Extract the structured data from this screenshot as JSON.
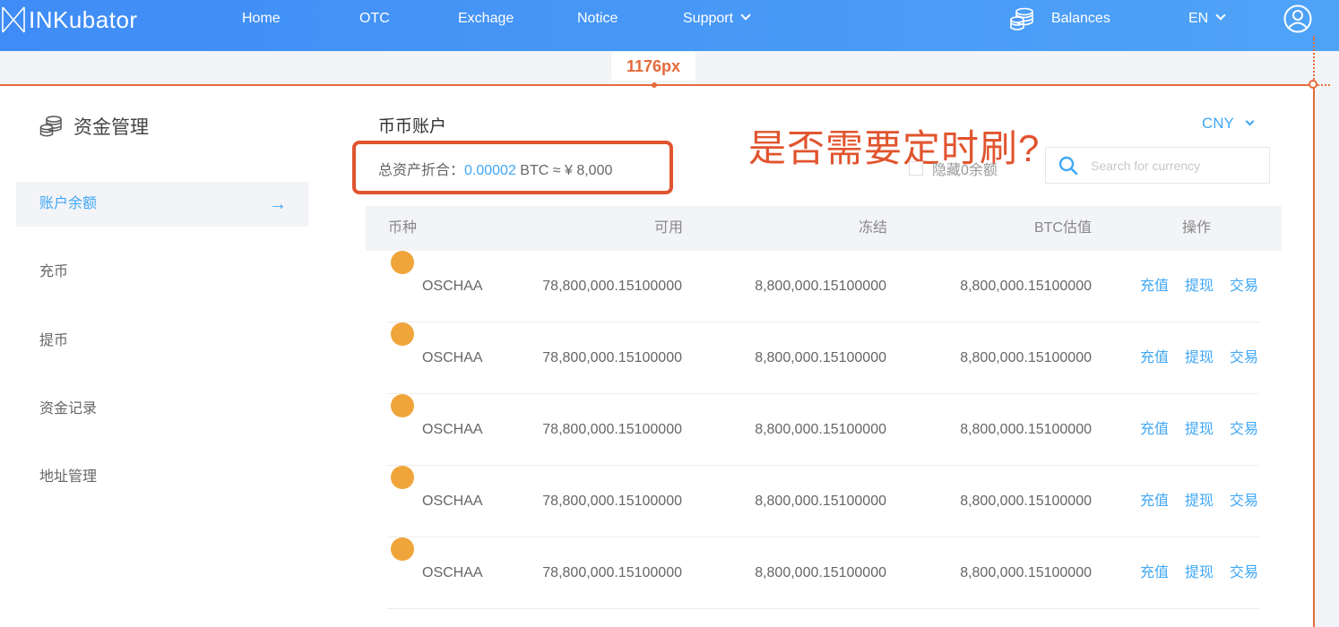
{
  "header": {
    "logo_text": "INKubator",
    "nav": [
      "Home",
      "OTC",
      "Exchage",
      "Notice",
      "Support"
    ],
    "balances_label": "Balances",
    "language": "EN"
  },
  "annotation": {
    "width_label": "1176px",
    "question": "是否需要定时刷?"
  },
  "sidebar": {
    "title": "资金管理",
    "items": [
      {
        "label": "账户余额",
        "active": true
      },
      {
        "label": "充币"
      },
      {
        "label": "提币"
      },
      {
        "label": "资金记录"
      },
      {
        "label": "地址管理"
      }
    ],
    "active_arrow": "→"
  },
  "main": {
    "title": "币币账户",
    "total_label": "总资产折合：",
    "total_btc": "0.00002",
    "total_rest": " BTC ≈ ¥ 8,000",
    "currency": "CNY",
    "hide_zero_label": "隐藏0余额",
    "search_placeholder": "Search for currency",
    "columns": [
      "币种",
      "可用",
      "冻结",
      "BTC估值",
      "操作"
    ],
    "rows": [
      {
        "coin": "OSCHAA",
        "available": "78,800,000.15100000",
        "frozen": "8,800,000.15100000",
        "btc_value": "8,800,000.15100000"
      },
      {
        "coin": "OSCHAA",
        "available": "78,800,000.15100000",
        "frozen": "8,800,000.15100000",
        "btc_value": "8,800,000.15100000"
      },
      {
        "coin": "OSCHAA",
        "available": "78,800,000.15100000",
        "frozen": "8,800,000.15100000",
        "btc_value": "8,800,000.15100000"
      },
      {
        "coin": "OSCHAA",
        "available": "78,800,000.15100000",
        "frozen": "8,800,000.15100000",
        "btc_value": "8,800,000.15100000"
      },
      {
        "coin": "OSCHAA",
        "available": "78,800,000.15100000",
        "frozen": "8,800,000.15100000",
        "btc_value": "8,800,000.15100000"
      }
    ],
    "actions": {
      "deposit": "充值",
      "withdraw": "提现",
      "trade": "交易"
    },
    "coin_symbol": "B"
  },
  "colors": {
    "accent": "#3fa7f5",
    "annotation": "#e1542e",
    "nav_bg": "#4a98f6"
  }
}
